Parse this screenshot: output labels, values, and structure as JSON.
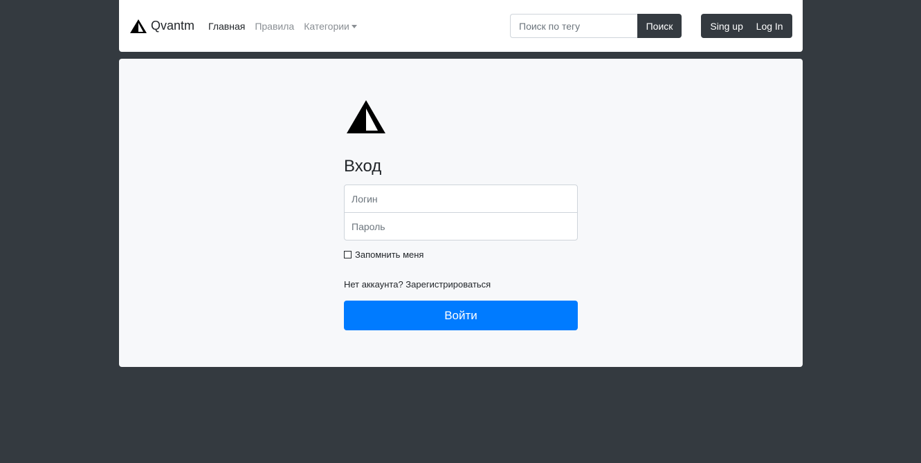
{
  "navbar": {
    "brand": "Qvantm",
    "nav_items": [
      {
        "label": "Главная",
        "active": true
      },
      {
        "label": "Правила",
        "active": false
      },
      {
        "label": "Категории",
        "active": false
      }
    ],
    "search": {
      "placeholder": "Поиск по тегу",
      "value": "",
      "button_label": "Поиск"
    },
    "auth": {
      "signup_label": "Sing up",
      "login_label": "Log In"
    }
  },
  "login_form": {
    "title": "Вход",
    "login_placeholder": "Логин",
    "password_placeholder": "Пароль",
    "remember_label": "Запомнить меня",
    "register_text": "Нет аккаунта? Зарегистрироваться",
    "submit_label": "Войти"
  },
  "colors": {
    "background": "#343a40",
    "card": "#f7f8fa",
    "primary": "#007bff",
    "dark_button": "#343a40"
  },
  "icons": {
    "brand_logo": "triangle-logo-icon",
    "dropdown": "caret-down-icon"
  }
}
